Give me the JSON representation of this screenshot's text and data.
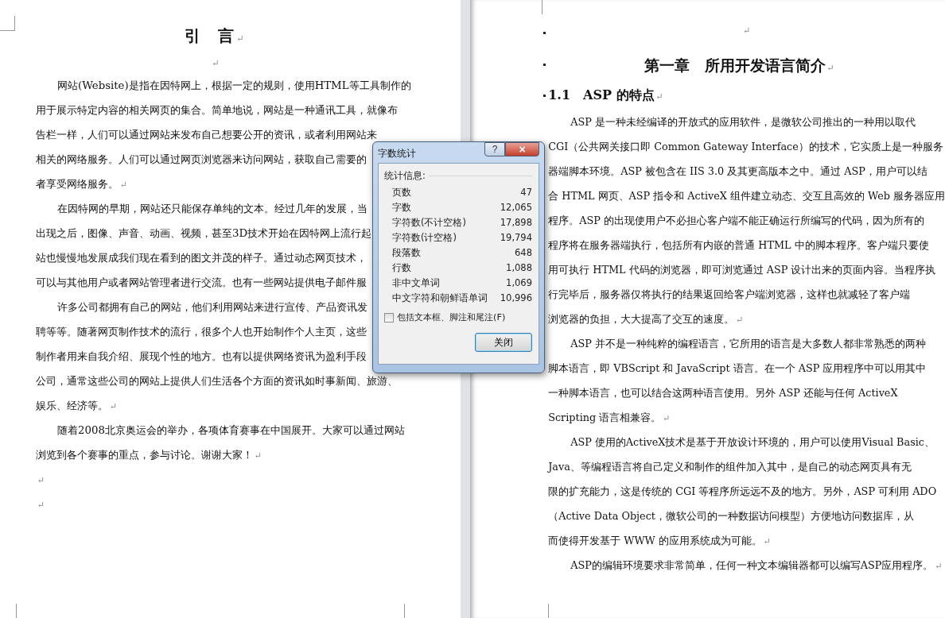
{
  "left_page": {
    "title": "引　言",
    "title_mark": "↵",
    "blank_mark": "↵",
    "paragraphs": [
      {
        "lines": [
          "网站(Website)是指在因特网上，根据一定的规则，使用HTML等工具制作的",
          "用于展示特定内容的相关网页的集合。简单地说，网站是一种通讯工具，就像布",
          "告栏一样，人们可以通过网站来发布自己想要公开的资讯，或者利用网站来",
          "相关的网络服务。人们可以通过网页浏览器来访问网站，获取自己需要的",
          "者享受网络服务。"
        ],
        "mark": "↵"
      },
      {
        "lines": [
          "在因特网的早期，网站还只能保存单纯的文本。经过几年的发展，当",
          "出现之后，图像、声音、动画、视频，甚至3D技术开始在因特网上流行起",
          "站也慢慢地发展成我们现在看到的图文并茂的样子。通过动态网页技术，",
          "可以与其他用户或者网站管理者进行交流。也有一些网站提供电子邮件服"
        ]
      },
      {
        "lines": [
          "许多公司都拥有自己的网站，他们利用网站来进行宣传、产品资讯发",
          "聘等等。随著网页制作技术的流行，很多个人也开始制作个人主页，这些",
          "制作者用来自我介绍、展现个性的地方。也有以提供网络资讯为盈利手段",
          "公司，通常这些公司的网站上提供人们生活各个方面的资讯如时事新闻、旅游、",
          "娱乐、经济等。"
        ],
        "mark": "↵"
      },
      {
        "lines": [
          "随着2008北京奥运会的举办，各项体育赛事在中国展开。大家可以通过网站",
          "浏览到各个赛事的重点，参与讨论。谢谢大家！"
        ],
        "mark": "↵"
      }
    ],
    "trailing_marks": [
      "↵",
      "↵"
    ]
  },
  "right_page": {
    "top_mark": "↵",
    "chapter_title": "第一章　所用开发语言简介",
    "chapter_mark": "↵",
    "section_title": "1.1　ASP 的特点",
    "section_mark": "↵",
    "paragraphs": [
      {
        "lines": [
          "ASP 是一种未经编译的开放式的应用软件，是微软公司推出的一种用以取代",
          "CGI（公共网关接口即 Common Gateway Interface）的技术，它实质上是一种服务",
          "器端脚本环境。ASP 被包含在 IIS 3.0 及其更高版本之中。通过 ASP，用户可以结",
          "合 HTML 网页、ASP 指令和 ActiveX 组件建立动态、交互且高效的 Web 服务器应用",
          "程序。ASP 的出现使用户不必担心客户端不能正确运行所编写的代码，因为所有的",
          "程序将在服务器端执行，包括所有内嵌的普通 HTML 中的脚本程序。客户端只要使",
          "用可执行 HTML 代码的浏览器，即可浏览通过 ASP 设计出来的页面内容。当程序执",
          "行完毕后，服务器仅将执行的结果返回给客户端浏览器，这样也就减轻了客户端",
          "浏览器的负担，大大提高了交互的速度。"
        ],
        "mark": "↵"
      },
      {
        "lines": [
          "ASP 并不是一种纯粹的编程语言，它所用的语言是大多数人都非常熟悉的两种",
          "脚本语言，即 VBScript 和 JavaScript 语言。在一个 ASP 应用程序中可以用其中",
          "一种脚本语言，也可以结合这两种语言使用。另外 ASP 还能与任何 ActiveX",
          "Scripting 语言相兼容。"
        ],
        "mark": "↵"
      },
      {
        "lines": [
          "ASP 使用的ActiveX技术是基于开放设计环境的，用户可以使用Visual Basic、",
          "Java、等编程语言将自己定义和制作的组件加入其中，是自己的动态网页具有无",
          "限的扩充能力，这是传统的 CGI 等程序所远远不及的地方。另外，ASP 可利用 ADO",
          "（Active Data Object，微软公司的一种数据访问模型）方便地访问数据库，从",
          "而使得开发基于 WWW 的应用系统成为可能。"
        ],
        "mark": "↵"
      },
      {
        "lines": [
          "ASP的编辑环境要求非常简单，任何一种文本编辑器都可以编写ASP应用程序。"
        ],
        "mark": "↵"
      }
    ]
  },
  "dialog": {
    "title": "字数统计",
    "help": "?",
    "close": "×",
    "group_label": "统计信息:",
    "stats": [
      {
        "label": "页数",
        "value": "47"
      },
      {
        "label": "字数",
        "value": "12,065"
      },
      {
        "label": "字符数(不计空格)",
        "value": "17,898"
      },
      {
        "label": "字符数(计空格)",
        "value": "19,794"
      },
      {
        "label": "段落数",
        "value": "648"
      },
      {
        "label": "行数",
        "value": "1,088"
      },
      {
        "label": "非中文单词",
        "value": "1,069"
      },
      {
        "label": "中文字符和朝鲜语单词",
        "value": "10,996"
      }
    ],
    "checkbox": {
      "label": "包括文本框、脚注和尾注(F)",
      "checked": false
    },
    "button": "关闭"
  }
}
